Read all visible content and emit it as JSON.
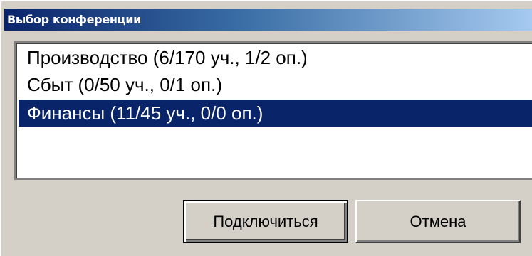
{
  "window": {
    "title": "Выбор конференции"
  },
  "conference_list": {
    "items": [
      {
        "label": "Производство (6/170 уч., 1/2 оп.)",
        "selected": false
      },
      {
        "label": "Сбыт (0/50 уч., 0/1 оп.)",
        "selected": false
      },
      {
        "label": "Финансы (11/45 уч., 0/0 оп.)",
        "selected": true
      }
    ]
  },
  "buttons": {
    "connect_label": "Подключиться",
    "cancel_label": "Отмена"
  },
  "colors": {
    "title_gradient_start": "#0a246a",
    "title_gradient_end": "#a6caf0",
    "selection_background": "#0a246a",
    "dialog_background": "#d4d0c8"
  }
}
